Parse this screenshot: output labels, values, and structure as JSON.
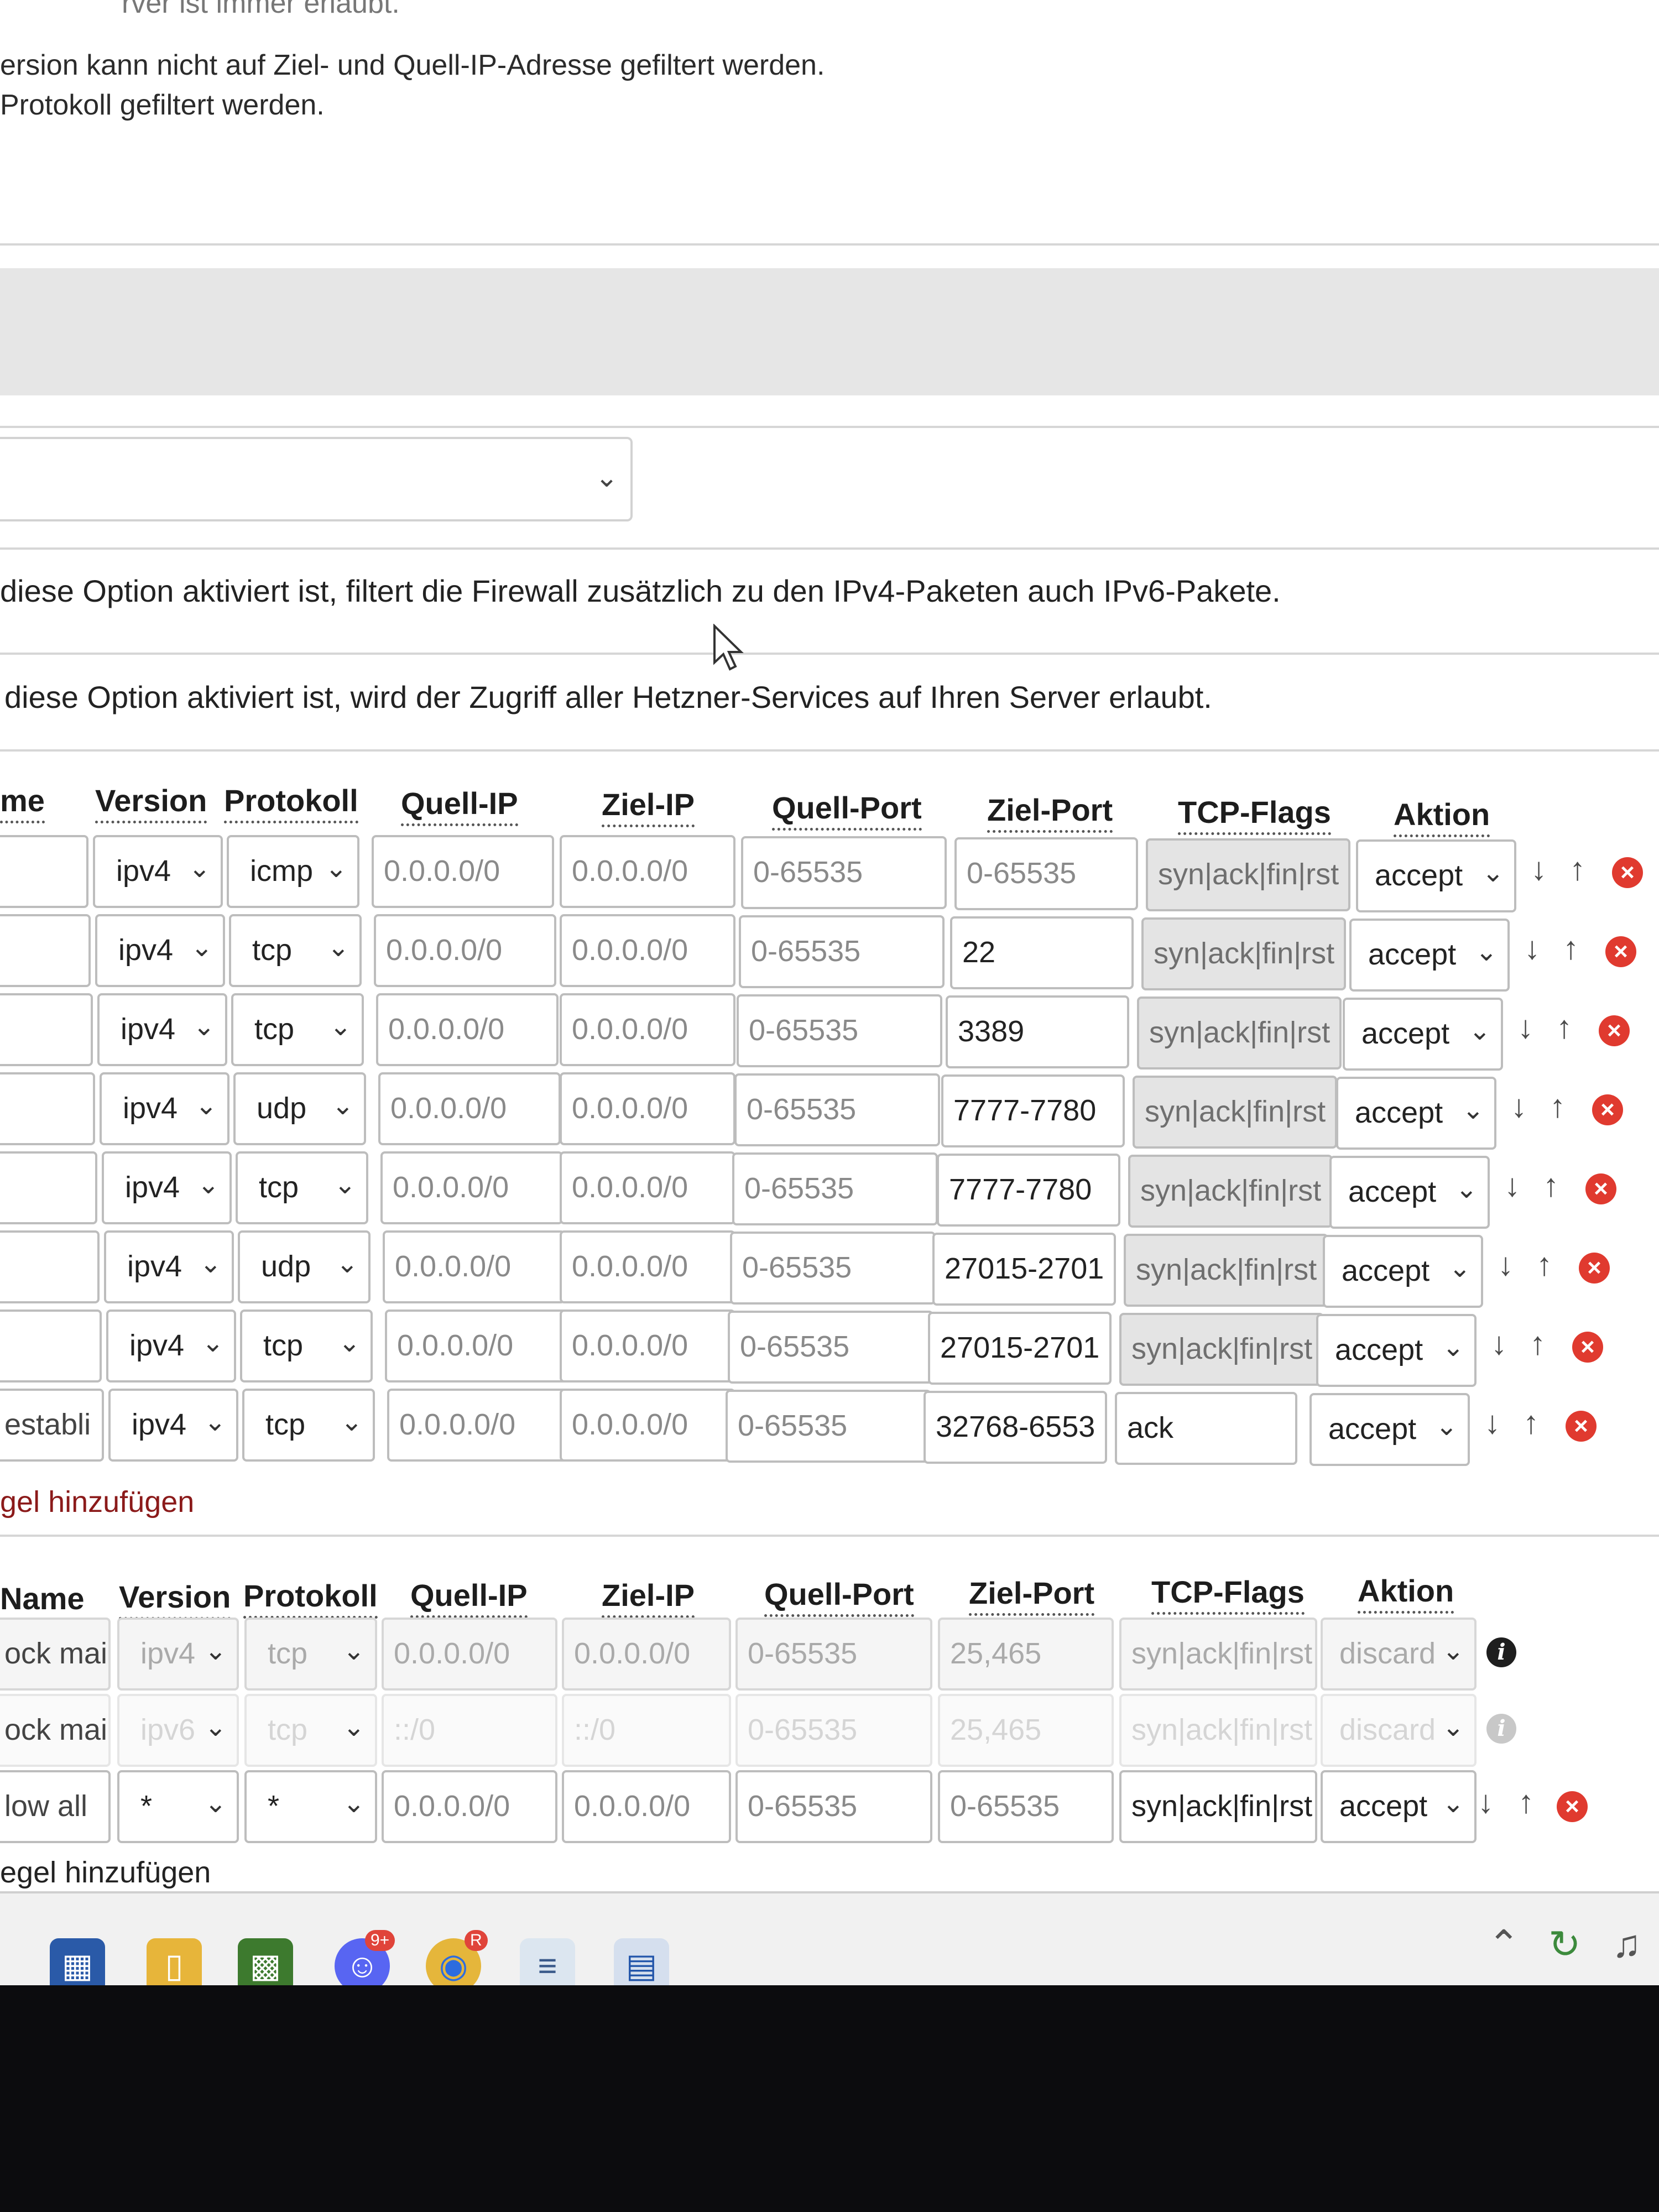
{
  "info": {
    "line1": "rver ist immer erlaubt.",
    "line2": "ersion kann nicht auf Ziel- und Quell-IP-Adresse gefiltert werden.",
    "line3": "Protokoll gefiltert werden."
  },
  "hints": {
    "ipv6": "diese Option aktiviert ist, filtert die Firewall zusätzlich zu den IPv4-Paketen auch IPv6-Pakete.",
    "hetzner": "diese Option aktiviert ist, wird der Zugriff aller Hetzner-Services auf Ihren Server erlaubt."
  },
  "table1": {
    "headers": {
      "name": "me",
      "version": "Version",
      "protocol": "Protokoll",
      "src_ip": "Quell-IP",
      "dst_ip": "Ziel-IP",
      "src_port": "Quell-Port",
      "dst_port": "Ziel-Port",
      "flags": "TCP-Flags",
      "action": "Aktion"
    },
    "rows": [
      {
        "name": "",
        "version": "ipv4",
        "protocol": "icmp",
        "src_ip": "0.0.0.0/0",
        "dst_ip": "0.0.0.0/0",
        "src_port": "0-65535",
        "dst_port": "0-65535",
        "flags": "syn|ack|fin|rst",
        "action": "accept"
      },
      {
        "name": "",
        "version": "ipv4",
        "protocol": "tcp",
        "src_ip": "0.0.0.0/0",
        "dst_ip": "0.0.0.0/0",
        "src_port": "0-65535",
        "dst_port": "22",
        "flags": "syn|ack|fin|rst",
        "action": "accept"
      },
      {
        "name": "",
        "version": "ipv4",
        "protocol": "tcp",
        "src_ip": "0.0.0.0/0",
        "dst_ip": "0.0.0.0/0",
        "src_port": "0-65535",
        "dst_port": "3389",
        "flags": "syn|ack|fin|rst",
        "action": "accept"
      },
      {
        "name": "",
        "version": "ipv4",
        "protocol": "udp",
        "src_ip": "0.0.0.0/0",
        "dst_ip": "0.0.0.0/0",
        "src_port": "0-65535",
        "dst_port": "7777-7780",
        "flags": "syn|ack|fin|rst",
        "action": "accept"
      },
      {
        "name": "",
        "version": "ipv4",
        "protocol": "tcp",
        "src_ip": "0.0.0.0/0",
        "dst_ip": "0.0.0.0/0",
        "src_port": "0-65535",
        "dst_port": "7777-7780",
        "flags": "syn|ack|fin|rst",
        "action": "accept"
      },
      {
        "name": "",
        "version": "ipv4",
        "protocol": "udp",
        "src_ip": "0.0.0.0/0",
        "dst_ip": "0.0.0.0/0",
        "src_port": "0-65535",
        "dst_port": "27015-2701",
        "flags": "syn|ack|fin|rst",
        "action": "accept"
      },
      {
        "name": "",
        "version": "ipv4",
        "protocol": "tcp",
        "src_ip": "0.0.0.0/0",
        "dst_ip": "0.0.0.0/0",
        "src_port": "0-65535",
        "dst_port": "27015-2701",
        "flags": "syn|ack|fin|rst",
        "action": "accept"
      },
      {
        "name": "establi",
        "version": "ipv4",
        "protocol": "tcp",
        "src_ip": "0.0.0.0/0",
        "dst_ip": "0.0.0.0/0",
        "src_port": "0-65535",
        "dst_port": "32768-6553",
        "flags": "ack",
        "action": "accept"
      }
    ],
    "add_label": "gel hinzufügen"
  },
  "table2": {
    "headers": {
      "name": "Name",
      "version": "Version",
      "protocol": "Protokoll",
      "src_ip": "Quell-IP",
      "dst_ip": "Ziel-IP",
      "src_port": "Quell-Port",
      "dst_port": "Ziel-Port",
      "flags": "TCP-Flags",
      "action": "Aktion"
    },
    "rows": [
      {
        "name": "ock mai",
        "version": "ipv4",
        "protocol": "tcp",
        "src_ip": "0.0.0.0/0",
        "dst_ip": "0.0.0.0/0",
        "src_port": "0-65535",
        "dst_port": "25,465",
        "flags": "syn|ack|fin|rst",
        "action": "discard"
      },
      {
        "name": "ock mai",
        "version": "ipv6",
        "protocol": "tcp",
        "src_ip": "::/0",
        "dst_ip": "::/0",
        "src_port": "0-65535",
        "dst_port": "25,465",
        "flags": "syn|ack|fin|rst",
        "action": "discard"
      },
      {
        "name": "low all",
        "version": "*",
        "protocol": "*",
        "src_ip": "0.0.0.0/0",
        "dst_ip": "0.0.0.0/0",
        "src_port": "0-65535",
        "dst_port": "0-65535",
        "flags": "syn|ack|fin|rst",
        "action": "accept"
      }
    ],
    "add_label": "egel hinzufügen"
  },
  "taskbar": {
    "discord_badge": "9+",
    "chrome_badge": "R",
    "icons": [
      "store-icon",
      "file-explorer-icon",
      "minecraft-icon",
      "discord-icon",
      "chrome-icon",
      "notepad-icon",
      "remote-desktop-icon"
    ]
  },
  "colors": {
    "delete": "#e03a2f",
    "flags_bg": "#e4e4e4",
    "border": "#bdbdbd"
  }
}
